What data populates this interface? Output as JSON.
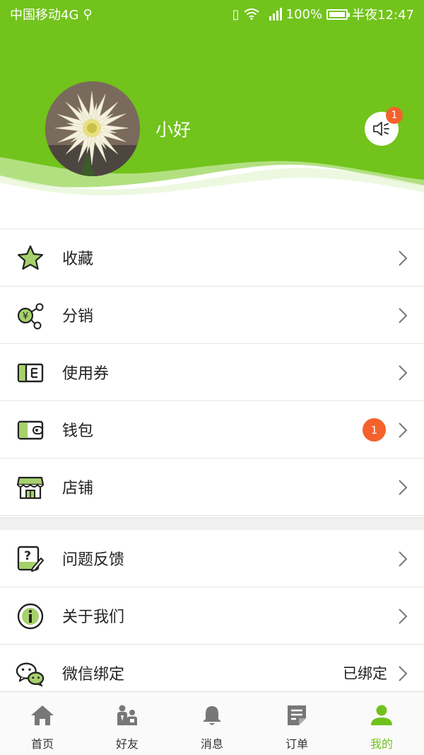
{
  "colors": {
    "brand": "#72c31c",
    "brand_light": "#9fd95a",
    "badge": "#f5612a",
    "icon_fill": "#a6d16c"
  },
  "status_bar": {
    "carrier": "中国移动4G",
    "battery": "100%",
    "time": "半夜12:47"
  },
  "profile": {
    "username": "小好",
    "notification_count": "1"
  },
  "menu_group1": [
    {
      "label": "收藏",
      "icon": "star-icon"
    },
    {
      "label": "分销",
      "icon": "distribution-icon"
    },
    {
      "label": "使用券",
      "icon": "coupon-icon"
    },
    {
      "label": "钱包",
      "icon": "wallet-icon",
      "badge": "1"
    },
    {
      "label": "店铺",
      "icon": "store-icon"
    }
  ],
  "menu_group2": [
    {
      "label": "问题反馈",
      "icon": "feedback-icon"
    },
    {
      "label": "关于我们",
      "icon": "info-icon"
    },
    {
      "label": "微信绑定",
      "icon": "wechat-icon",
      "right_text": "已绑定"
    }
  ],
  "tabbar": {
    "tabs": [
      {
        "label": "首页",
        "icon": "home-icon"
      },
      {
        "label": "好友",
        "icon": "friends-icon"
      },
      {
        "label": "消息",
        "icon": "bell-icon"
      },
      {
        "label": "订单",
        "icon": "order-icon"
      },
      {
        "label": "我的",
        "icon": "person-icon",
        "active": true
      }
    ]
  }
}
